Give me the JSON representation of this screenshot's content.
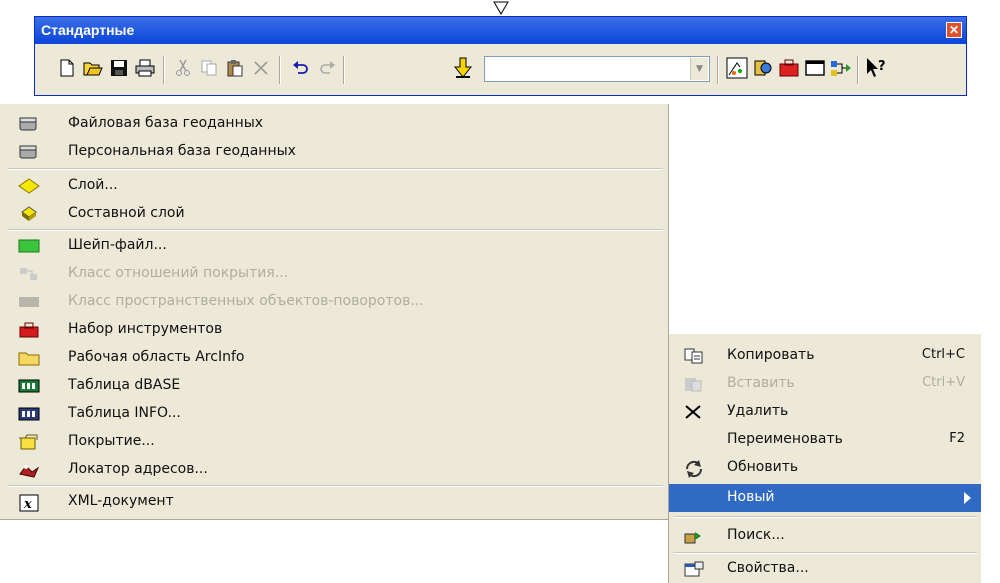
{
  "toolbar": {
    "title": "Стандартные",
    "close_glyph": "✕",
    "combo_value": "",
    "buttons": [
      "new-icon",
      "open-icon",
      "save-icon",
      "print-icon",
      "cut-icon",
      "copy-icon",
      "paste-icon",
      "delete-icon",
      "undo-icon",
      "redo-icon",
      "add-data-icon",
      "editor-icon",
      "catalog-icon",
      "arctoolbox-icon",
      "command-line-icon",
      "model-builder-icon",
      "whats-this-icon"
    ]
  },
  "main_menu": {
    "items": [
      {
        "label": "Файловая база геоданных",
        "icon": "file-geodatabase-icon",
        "enabled": true
      },
      {
        "label": "Персональная база геоданных",
        "icon": "personal-geodatabase-icon",
        "enabled": true
      },
      {
        "label": "Слой...",
        "icon": "layer-icon",
        "enabled": true
      },
      {
        "label": "Составной слой",
        "icon": "group-layer-icon",
        "enabled": true
      },
      {
        "label": "Шейп-файл...",
        "icon": "shapefile-icon",
        "enabled": true
      },
      {
        "label": "Класс отношений покрытия...",
        "icon": "coverage-relationship-icon",
        "enabled": false
      },
      {
        "label": "Класс пространственных объектов-поворотов...",
        "icon": "turn-feature-class-icon",
        "enabled": false
      },
      {
        "label": "Набор инструментов",
        "icon": "toolbox-icon",
        "enabled": true
      },
      {
        "label": "Рабочая область ArcInfo",
        "icon": "arcinfo-workspace-icon",
        "enabled": true
      },
      {
        "label": "Таблица dBASE",
        "icon": "dbase-table-icon",
        "enabled": true
      },
      {
        "label": "Таблица INFO...",
        "icon": "info-table-icon",
        "enabled": true
      },
      {
        "label": "Покрытие...",
        "icon": "coverage-icon",
        "enabled": true
      },
      {
        "label": "Локатор адресов...",
        "icon": "address-locator-icon",
        "enabled": true
      },
      {
        "label": "XML-документ",
        "icon": "xml-document-icon",
        "enabled": true
      }
    ]
  },
  "context_menu": {
    "items": [
      {
        "label": "Копировать",
        "shortcut": "Ctrl+C",
        "icon": "copy-icon",
        "enabled": true
      },
      {
        "label": "Вставить",
        "shortcut": "Ctrl+V",
        "icon": "paste-icon",
        "enabled": false
      },
      {
        "label": "Удалить",
        "shortcut": "",
        "icon": "delete-icon",
        "enabled": true
      },
      {
        "label": "Переименовать",
        "shortcut": "F2",
        "icon": "",
        "enabled": true
      },
      {
        "label": "Обновить",
        "shortcut": "",
        "icon": "refresh-icon",
        "enabled": true
      },
      {
        "label": "Новый",
        "shortcut": "",
        "icon": "",
        "enabled": true,
        "selected": true
      },
      {
        "label": "Поиск...",
        "shortcut": "",
        "icon": "search-icon",
        "enabled": true
      },
      {
        "label": "Свойства...",
        "shortcut": "",
        "icon": "properties-icon",
        "enabled": true
      }
    ]
  },
  "colors": {
    "titlebar": "#0b45d8",
    "menu_bg": "#ece9d8",
    "highlight": "#316ac5",
    "disabled_text": "#b0ae9e"
  }
}
